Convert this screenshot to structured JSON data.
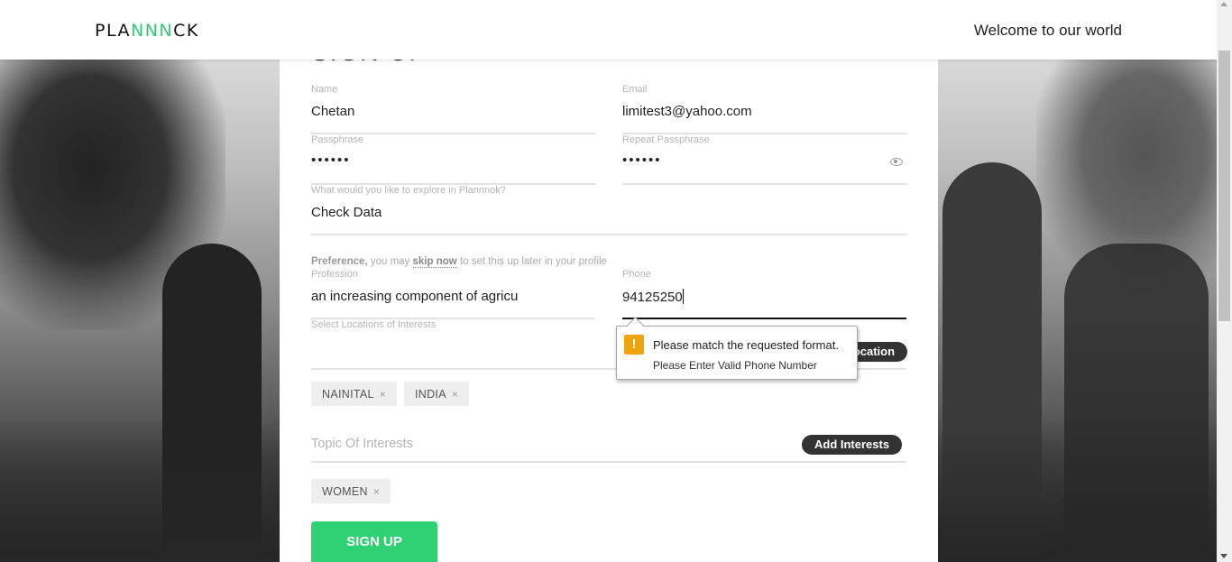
{
  "header": {
    "logo_prefix": "PLA",
    "logo_mid": "NNN",
    "logo_suffix": "CK",
    "welcome": "Welcome to our world"
  },
  "form": {
    "heading": "SIGN UP",
    "name": {
      "label": "Name",
      "value": "Chetan"
    },
    "email": {
      "label": "Email",
      "value": "limitest3@yahoo.com"
    },
    "passphrase": {
      "label": "Passphrase",
      "value": "••••••"
    },
    "repeat_passphrase": {
      "label": "Repeat Passphrase",
      "value": "••••••"
    },
    "explore": {
      "label": "What would you like to explore in Plannnok?",
      "value": "Check Data"
    },
    "preference": {
      "bold": "Preference,",
      "text1": " you may ",
      "skip": "skip now",
      "text2": " to set this up later in your profile"
    },
    "profession": {
      "label": "Profession",
      "value": "an increasing component of agricu"
    },
    "phone": {
      "label": "Phone",
      "value": "94125250"
    },
    "locations": {
      "label": "Select Locations of Interests",
      "button": "Add Location",
      "tags": [
        "NAINITAL",
        "INDIA"
      ]
    },
    "topics": {
      "placeholder": "Topic Of Interests",
      "button": "Add Interests",
      "tags": [
        "WOMEN"
      ]
    },
    "submit": "SIGN UP",
    "remove_symbol": "×"
  },
  "tooltip": {
    "icon": "!",
    "message": "Please match the requested format.",
    "detail": "Please Enter Valid Phone Number"
  },
  "colors": {
    "accent": "#2fd272",
    "warning": "#f0a30a",
    "pill": "#333333"
  }
}
